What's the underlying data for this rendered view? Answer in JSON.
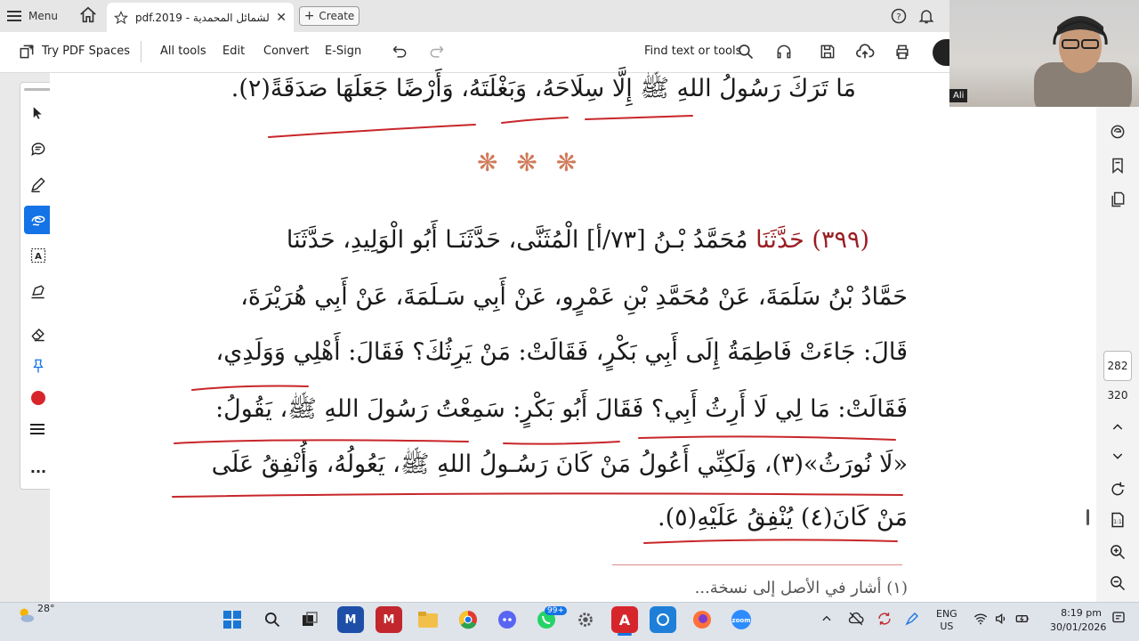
{
  "tabbar": {
    "menu_label": "Menu",
    "tab_title": "pdf.2019 - الشمائل المحمدية",
    "create_label": "Create"
  },
  "toolbar": {
    "try_spaces": "Try PDF Spaces",
    "all_tools": "All tools",
    "edit": "Edit",
    "convert": "Convert",
    "esign": "E-Sign",
    "find": "Find text or tools"
  },
  "document": {
    "lines": [
      "مَا تَرَكَ رَسُولُ اللهِ ﷺ إِلَّا سِلَاحَهُ، وَبَغْلَتَهُ، وَأَرْضًا جَعَلَهَا صَدَقَةً(٢).",
      "❋ ❋ ❋",
      "(٣٩٩) حَدَّثَنَا مُحَمَّدُ بْـنُ [٧٣/أ] الْمُثَنَّى، حَدَّثَنَـا أَبُو الْوَلِيدِ، حَدَّثَنَا",
      "حَمَّادُ بْنُ سَلَمَةَ، عَنْ مُحَمَّدِ بْنِ عَمْرٍو، عَنْ أَبِي سَـلَمَةَ، عَنْ أَبِي هُرَيْرَةَ،",
      "قَالَ: جَاءَتْ فَاطِمَةُ إِلَى أَبِي بَكْرٍ، فَقَالَتْ: مَنْ يَرِثُكَ؟ فَقَالَ: أَهْلِي وَوَلَدِي،",
      "فَقَالَتْ: مَا لِي لَا أَرِثُ أَبِي؟ فَقَالَ أَبُو بَكْرٍ: سَمِعْتُ رَسُولَ اللهِ ﷺ، يَقُولُ:",
      "«لَا نُورَثُ»(٣)، وَلَكِنِّي أَعُولُ مَنْ كَانَ رَسُـولُ اللهِ ﷺ، يَعُولُهُ، وَأُنْفِقُ عَلَى",
      "مَنْ كَانَ(٤) يُنْفِقُ عَلَيْهِ(٥).",
      "(١) أشار في الأصل إلى نسخة..."
    ],
    "hadith_number": "(٣٩٩)",
    "hadith_word": "حَدَّثَنَا"
  },
  "pages": {
    "current": "282",
    "total": "320"
  },
  "webcam": {
    "name": "Ali"
  },
  "taskbar": {
    "weather": "28°",
    "whatsapp_badge": "99+",
    "lang1": "ENG",
    "lang2": "US",
    "time": "8:19 pm",
    "date": "30/01/2026"
  },
  "colors": {
    "accent": "#1473e6",
    "annotation_red": "#c8262a",
    "record_red": "#d7262b"
  }
}
